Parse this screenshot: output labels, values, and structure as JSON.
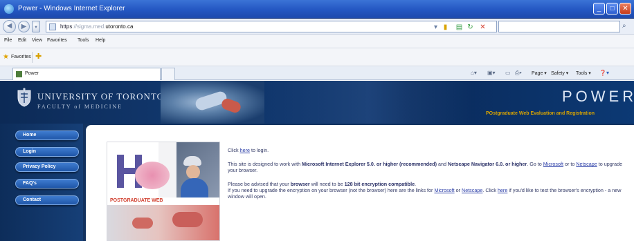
{
  "window": {
    "title": "Power - Windows Internet Explorer",
    "buttons": [
      "_",
      "□",
      "✕"
    ]
  },
  "address": {
    "url_prefix": "https",
    "url_domain": "utoronto.ca",
    "url_middle": "://sigma.med.",
    "search_placeholder": ""
  },
  "menu": [
    "File",
    "Edit",
    "View",
    "Favorites",
    "Tools",
    "Help"
  ],
  "favorites": {
    "label": "Favorites"
  },
  "tab": {
    "label": "Power"
  },
  "commandbar": {
    "items": [
      "Page ▾",
      "Safety ▾",
      "Tools ▾"
    ]
  },
  "header": {
    "university": "UNIVERSITY OF TORONTO",
    "faculty": "FACULTY of MEDICINE",
    "app_name": "POWER",
    "app_subtitle": "POstgraduate Web Evaluation and Registration"
  },
  "nav": [
    "Home",
    "Login",
    "Privacy Policy",
    "FAQ's",
    "Contact"
  ],
  "collage": {
    "strip_text": "POSTGRADUATE WEB"
  },
  "body": {
    "p1_before": "Click ",
    "p1_link": "here",
    "p1_after": " to login.",
    "p2_a": "This site is designed to work with ",
    "p2_b": "Microsoft Internet Explorer 5.0. or higher (recommended)",
    "p2_c": " and ",
    "p2_d": "Netscape Navigator 6.0. or higher",
    "p2_e": ". Go to ",
    "p2_link1": "Microsoft",
    "p2_f": " or to ",
    "p2_link2": "Netscape",
    "p2_g": " to upgrade your browser.",
    "p3_a": "Please be advised that your ",
    "p3_b": "browser",
    "p3_c": " will need to be ",
    "p3_d": "128 bit encryption compatible",
    "p3_e": ".",
    "p3_f": "If you need to upgrade the encryption on your browser (not the browser) here are the links for ",
    "p3_link1": "Microsoft",
    "p3_g": " or ",
    "p3_link2": "Netscape",
    "p3_h": ". Click ",
    "p3_link3": "here",
    "p3_i": " if you'd like to test the browser's encryption - a new window will open."
  }
}
